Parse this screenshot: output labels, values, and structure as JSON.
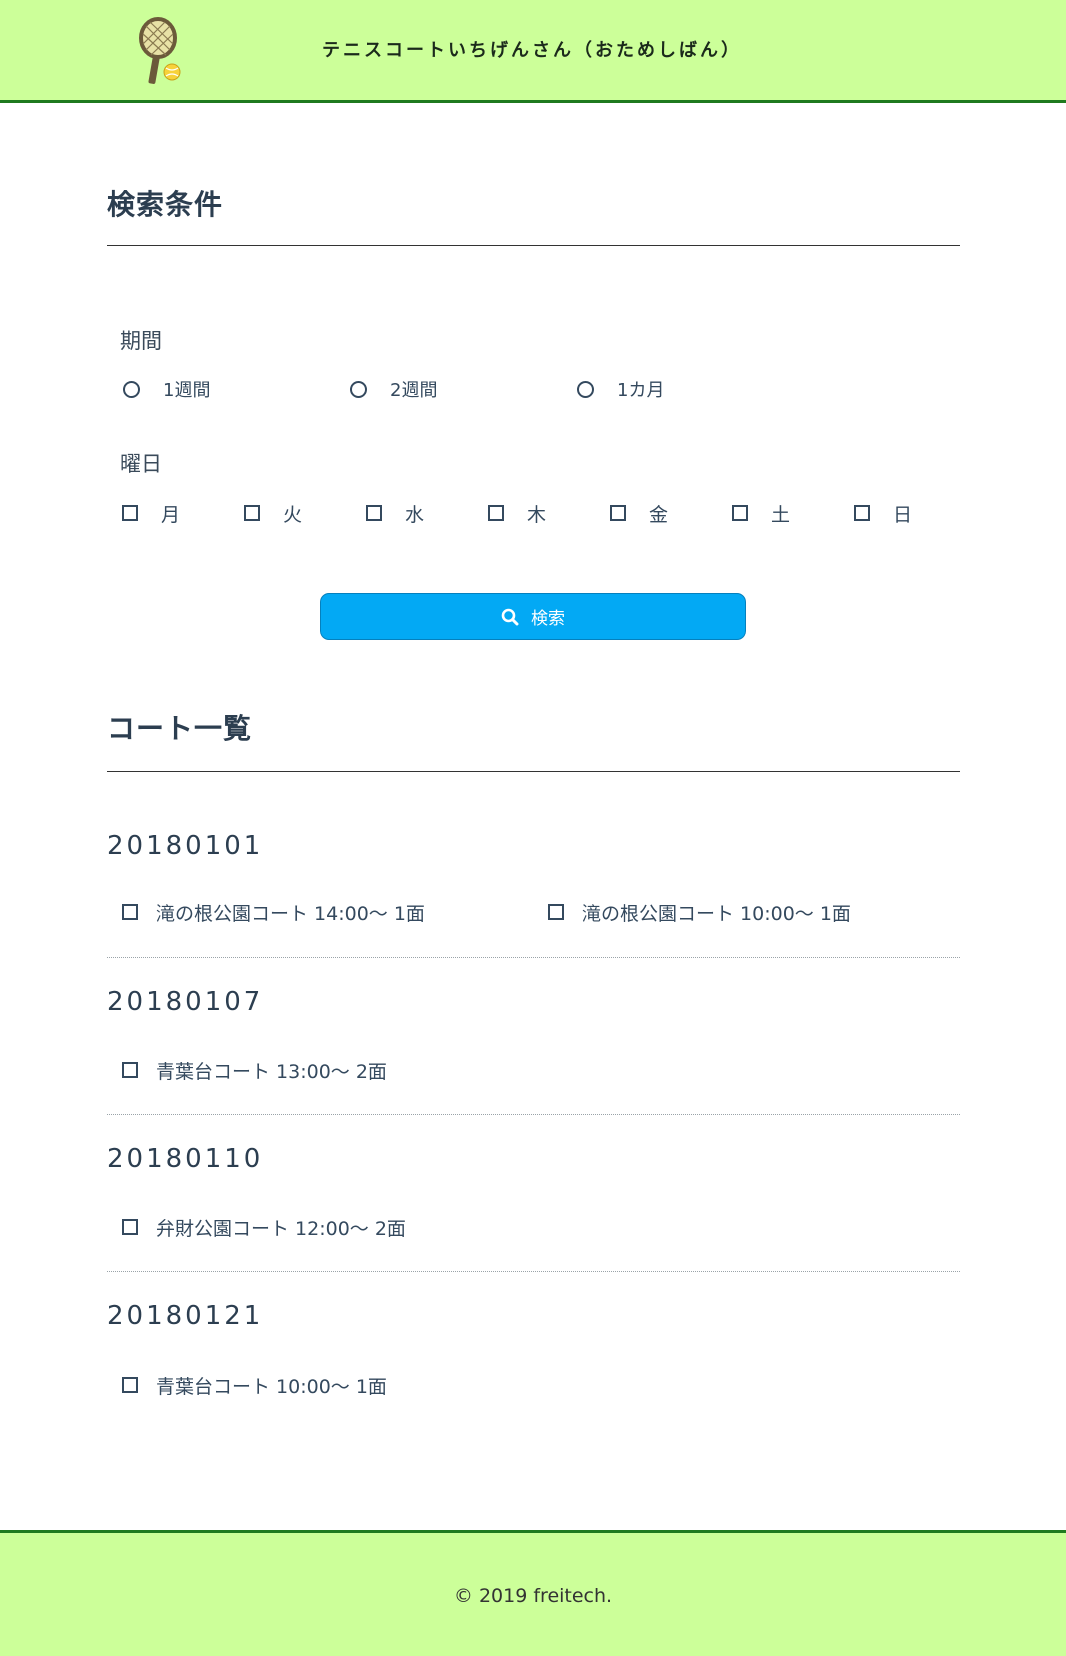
{
  "header": {
    "title": "テニスコートいちげんさん（おためしばん）",
    "logo_icon": "tennis-racket-icon"
  },
  "search_conditions": {
    "heading": "検索条件",
    "period": {
      "label": "期間",
      "options": [
        "1週間",
        "2週間",
        "1カ月"
      ]
    },
    "weekday": {
      "label": "曜日",
      "options": [
        "月",
        "火",
        "水",
        "木",
        "金",
        "土",
        "日"
      ]
    },
    "search_button": {
      "label": "検索",
      "icon": "search-icon"
    }
  },
  "court_list": {
    "heading": "コート一覧",
    "groups": [
      {
        "date": "20180101",
        "courts": [
          "滝の根公園コート 14:00〜 1面",
          "滝の根公園コート 10:00〜 1面"
        ]
      },
      {
        "date": "20180107",
        "courts": [
          "青葉台コート 13:00〜 2面"
        ]
      },
      {
        "date": "20180110",
        "courts": [
          "弁財公園コート 12:00〜 2面"
        ]
      },
      {
        "date": "20180121",
        "courts": [
          "青葉台コート 10:00〜 1面"
        ]
      }
    ]
  },
  "footer": {
    "copyright": "© 2019 freitech."
  },
  "colors": {
    "header_bg": "#ccff99",
    "header_border": "#1f7a1f",
    "button_bg": "#03a9f4",
    "text": "#34495e"
  }
}
